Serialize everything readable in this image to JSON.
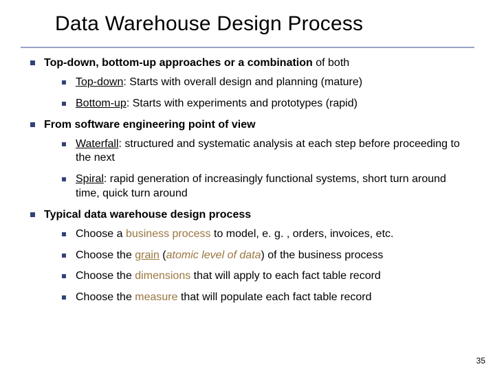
{
  "title": "Data Warehouse Design Process",
  "b1": {
    "lead_bold": "Top-down, bottom-up approaches or a combination",
    "lead_tail": " of both",
    "sub1_u": "Top-down",
    "sub1_rest": ": Starts with overall design and planning (mature)",
    "sub2_u": "Bottom-up",
    "sub2_rest": ": Starts with experiments and prototypes (rapid)"
  },
  "b2": {
    "lead_bold": "From software engineering point of view",
    "sub1_u": "Waterfall",
    "sub1_rest": ": structured and systematic analysis at each step before proceeding to the next",
    "sub2_u": "Spiral",
    "sub2_rest": ":  rapid generation of increasingly functional systems, short turn around time, quick turn around"
  },
  "b3": {
    "lead_bold": "Typical data warehouse design process",
    "sub1_a": "Choose a ",
    "sub1_hl": "business process",
    "sub1_b": " to model, e. g. , orders, invoices, etc.",
    "sub2_a": "Choose the ",
    "sub2_hl_u": "grain",
    "sub2_b": " (",
    "sub2_hl_i": "atomic level of data",
    "sub2_c": ") of the business process",
    "sub3_a": "Choose the ",
    "sub3_hl": "dimensions",
    "sub3_b": " that will apply to each fact table record",
    "sub4_a": "Choose the ",
    "sub4_hl": "measure",
    "sub4_b": " that will populate each fact table record"
  },
  "page_number": "35"
}
